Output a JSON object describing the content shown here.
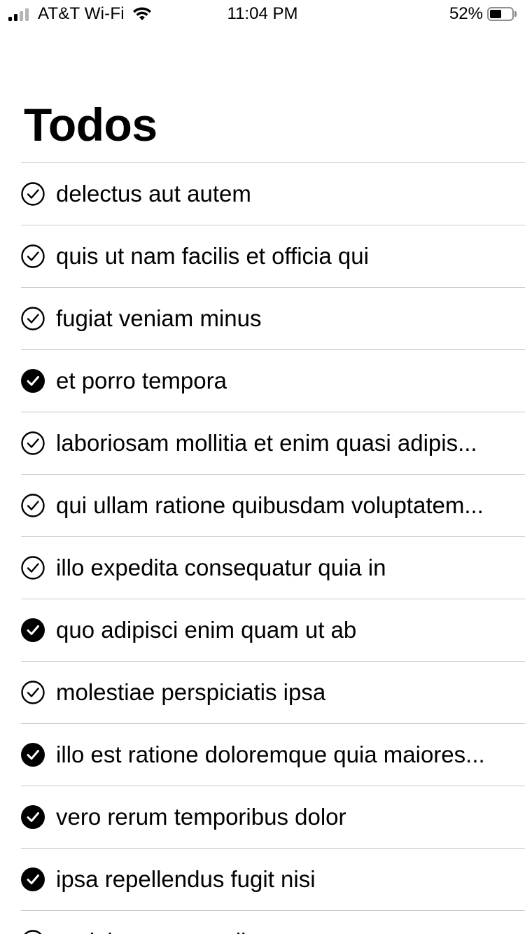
{
  "status_bar": {
    "carrier": "AT&T Wi-Fi",
    "time": "11:04 PM",
    "battery_percent": "52%",
    "battery_level": 0.52,
    "signal_bars_active": 2,
    "signal_bars_total": 4
  },
  "page": {
    "title": "Todos"
  },
  "colors": {
    "text": "#000000",
    "separator": "#c8c7cc",
    "background": "#ffffff"
  },
  "todos": [
    {
      "title": "delectus aut autem",
      "completed": false
    },
    {
      "title": "quis ut nam facilis et officia qui",
      "completed": false
    },
    {
      "title": "fugiat veniam minus",
      "completed": false
    },
    {
      "title": "et porro tempora",
      "completed": true
    },
    {
      "title": "laboriosam mollitia et enim quasi adipis...",
      "completed": false
    },
    {
      "title": "qui ullam ratione quibusdam voluptatem...",
      "completed": false
    },
    {
      "title": "illo expedita consequatur quia in",
      "completed": false
    },
    {
      "title": "quo adipisci enim quam ut ab",
      "completed": true
    },
    {
      "title": "molestiae perspiciatis ipsa",
      "completed": false
    },
    {
      "title": "illo est ratione doloremque quia maiores...",
      "completed": true
    },
    {
      "title": "vero rerum temporibus dolor",
      "completed": true
    },
    {
      "title": "ipsa repellendus fugit nisi",
      "completed": true
    },
    {
      "title": "et doloremque nulla",
      "completed": false
    }
  ]
}
